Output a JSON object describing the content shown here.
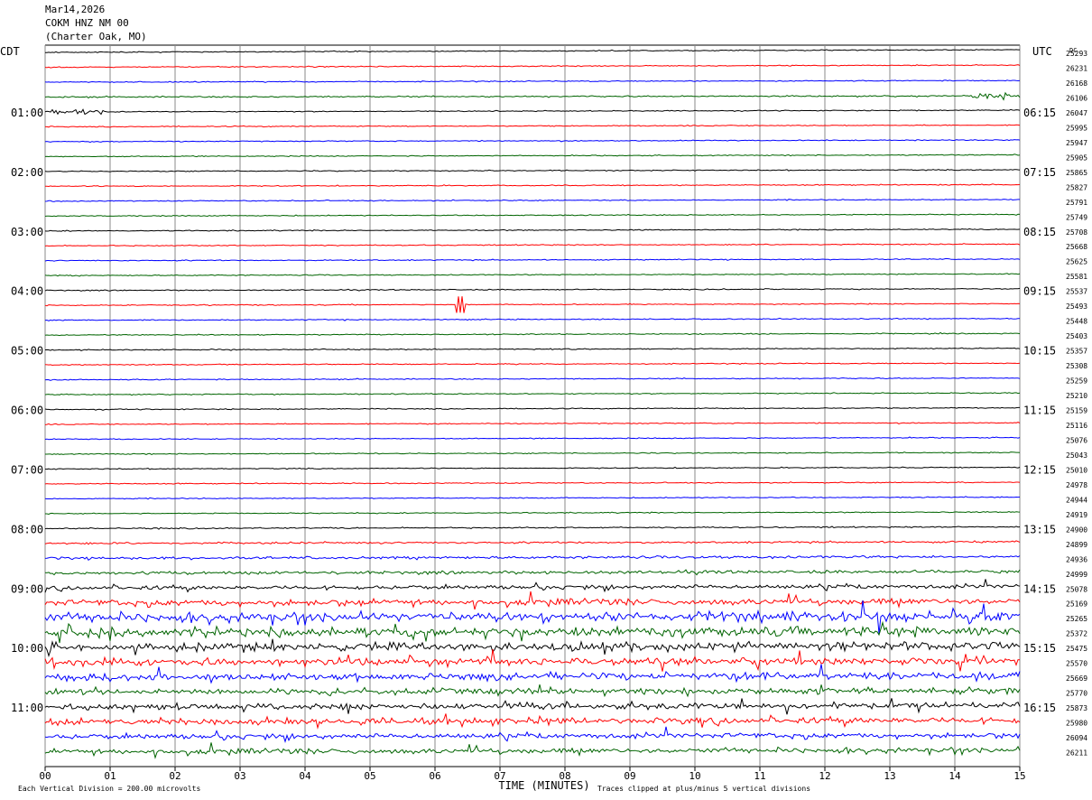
{
  "header": {
    "date": "Mar14,2026",
    "station": "COKM HNZ NM 00",
    "location": "(Charter Oak, MO)"
  },
  "chart_data": {
    "type": "line",
    "title": "COKM HNZ NM 00",
    "xlabel": "TIME (MINUTES)",
    "ylabel_left": "CDT",
    "ylabel_right": "UTC",
    "dc_label": "DC",
    "x_ticks": [
      "00",
      "01",
      "02",
      "03",
      "04",
      "05",
      "06",
      "07",
      "08",
      "09",
      "10",
      "11",
      "12",
      "13",
      "14",
      "15"
    ],
    "xlim": [
      0,
      15
    ],
    "rows_per_hour": 4,
    "row_colors": [
      "#000000",
      "#ff0000",
      "#0000ff",
      "#006400"
    ],
    "left_hour_labels": [
      "01:00",
      "02:00",
      "03:00",
      "04:00",
      "05:00",
      "06:00",
      "07:00",
      "08:00",
      "09:00",
      "10:00",
      "11:00"
    ],
    "right_hour_labels": [
      "06:15",
      "07:15",
      "08:15",
      "09:15",
      "10:15",
      "11:15",
      "12:15",
      "13:15",
      "14:15",
      "15:15",
      "16:15"
    ],
    "dc_offsets": [
      "25293",
      "26231",
      "26168",
      "26106",
      "26047",
      "25995",
      "25947",
      "25905",
      "25865",
      "25827",
      "25791",
      "25749",
      "25708",
      "25668",
      "25625",
      "25581",
      "25537",
      "25493",
      "25448",
      "25403",
      "25357",
      "25308",
      "25259",
      "25210",
      "25159",
      "25116",
      "25076",
      "25043",
      "25010",
      "24978",
      "24944",
      "24919",
      "24900",
      "24899",
      "24936",
      "24999",
      "25078",
      "25169",
      "25265",
      "25372",
      "25475",
      "25570",
      "25669",
      "25770",
      "25873",
      "25980",
      "26094",
      "26211"
    ],
    "noise_levels": [
      1,
      1,
      1,
      1.3,
      1,
      1,
      1,
      1,
      1,
      1,
      1,
      1,
      1,
      1,
      1,
      1,
      1,
      1,
      1,
      1,
      1,
      1,
      1,
      1,
      1,
      1,
      1,
      1,
      1,
      1,
      1,
      1,
      1.3,
      1.8,
      2.5,
      3,
      4,
      6,
      9,
      9,
      8,
      7,
      7,
      6,
      6,
      6,
      5,
      5
    ],
    "footer_left": "Each Vertical Division =  200.00 microvolts",
    "footer_right": "Traces clipped at plus/minus 5 vertical divisions"
  }
}
